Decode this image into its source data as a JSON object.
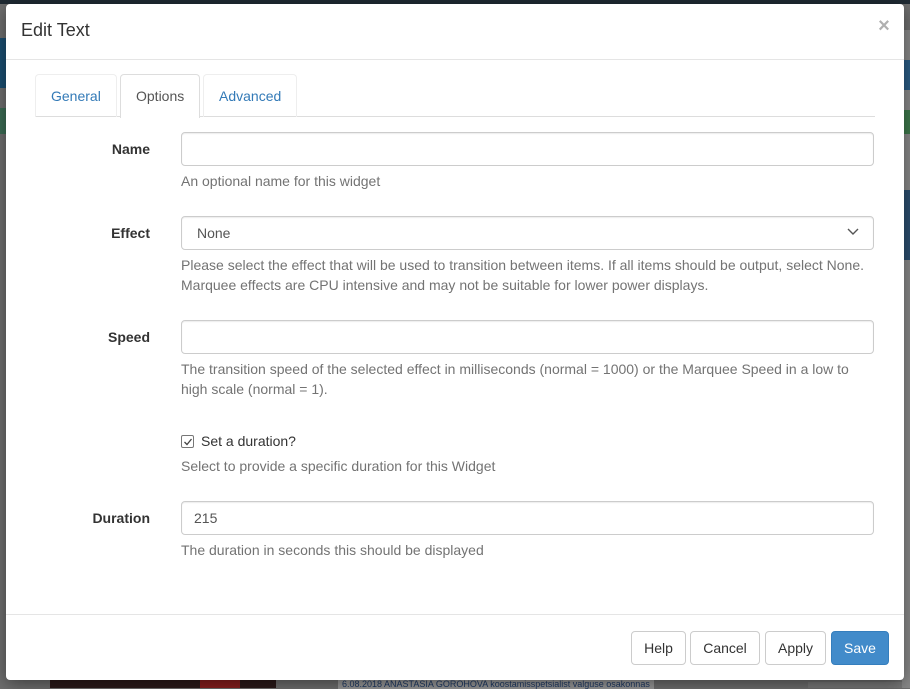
{
  "background": {
    "bottom_text": "6.08.2018 ANASTASIA GOROHOVA koostamisspetsialist valguse osakonnas"
  },
  "modal": {
    "title": "Edit Text",
    "close_symbol": "×"
  },
  "tabs": [
    {
      "label": "General",
      "active": false
    },
    {
      "label": "Options",
      "active": true
    },
    {
      "label": "Advanced",
      "active": false
    }
  ],
  "form": {
    "name": {
      "label": "Name",
      "value": "",
      "help": "An optional name for this widget"
    },
    "effect": {
      "label": "Effect",
      "selected": "None",
      "help": "Please select the effect that will be used to transition between items. If all items should be output, select None. Marquee effects are CPU intensive and may not be suitable for lower power displays."
    },
    "speed": {
      "label": "Speed",
      "value": "",
      "help": "The transition speed of the selected effect in milliseconds (normal = 1000) or the Marquee Speed in a low to high scale (normal = 1)."
    },
    "set_duration": {
      "label": "Set a duration?",
      "checked": true,
      "help": "Select to provide a specific duration for this Widget"
    },
    "duration": {
      "label": "Duration",
      "value": "215",
      "help": "The duration in seconds this should be displayed"
    }
  },
  "footer": {
    "help": "Help",
    "cancel": "Cancel",
    "apply": "Apply",
    "save": "Save"
  },
  "colors": {
    "primary": "#428bca",
    "link": "#337ab7",
    "help_text": "#737373"
  }
}
